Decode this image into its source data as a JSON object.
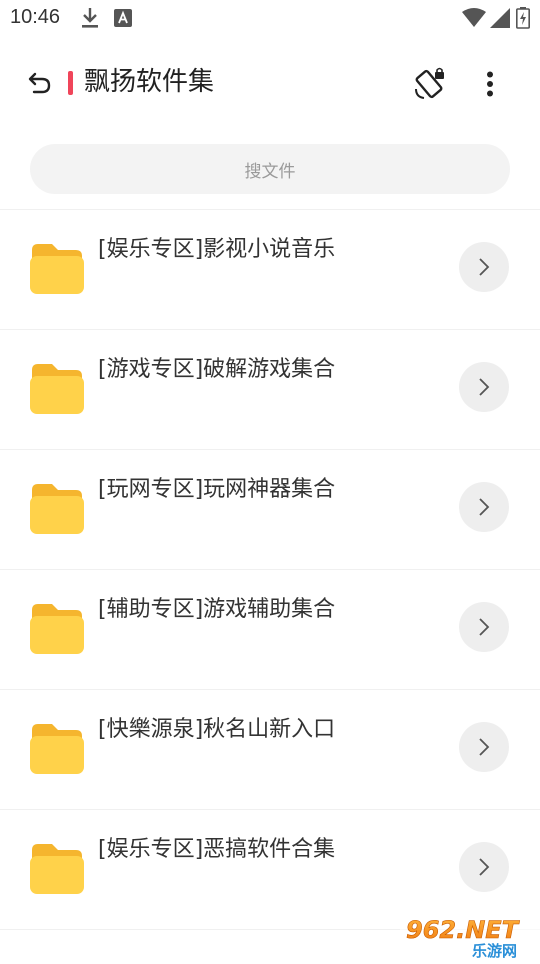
{
  "status_bar": {
    "time": "10:46"
  },
  "app_bar": {
    "title": "飘扬软件集"
  },
  "search": {
    "placeholder": "搜文件"
  },
  "folders": [
    {
      "label": "[娱乐专区]影视小说音乐"
    },
    {
      "label": "[游戏专区]破解游戏集合"
    },
    {
      "label": "[玩网专区]玩网神器集合"
    },
    {
      "label": "[辅助专区]游戏辅助集合"
    },
    {
      "label": "[快樂源泉]秋名山新入口"
    },
    {
      "label": "[娱乐专区]恶搞软件合集"
    }
  ],
  "watermark": {
    "line1": "962.NET",
    "line2": "乐游网"
  },
  "colors": {
    "accent": "#f0455a",
    "folder_body": "#ffd24a",
    "folder_tab": "#f5b52e",
    "chevron_bg": "#eeeeee"
  }
}
